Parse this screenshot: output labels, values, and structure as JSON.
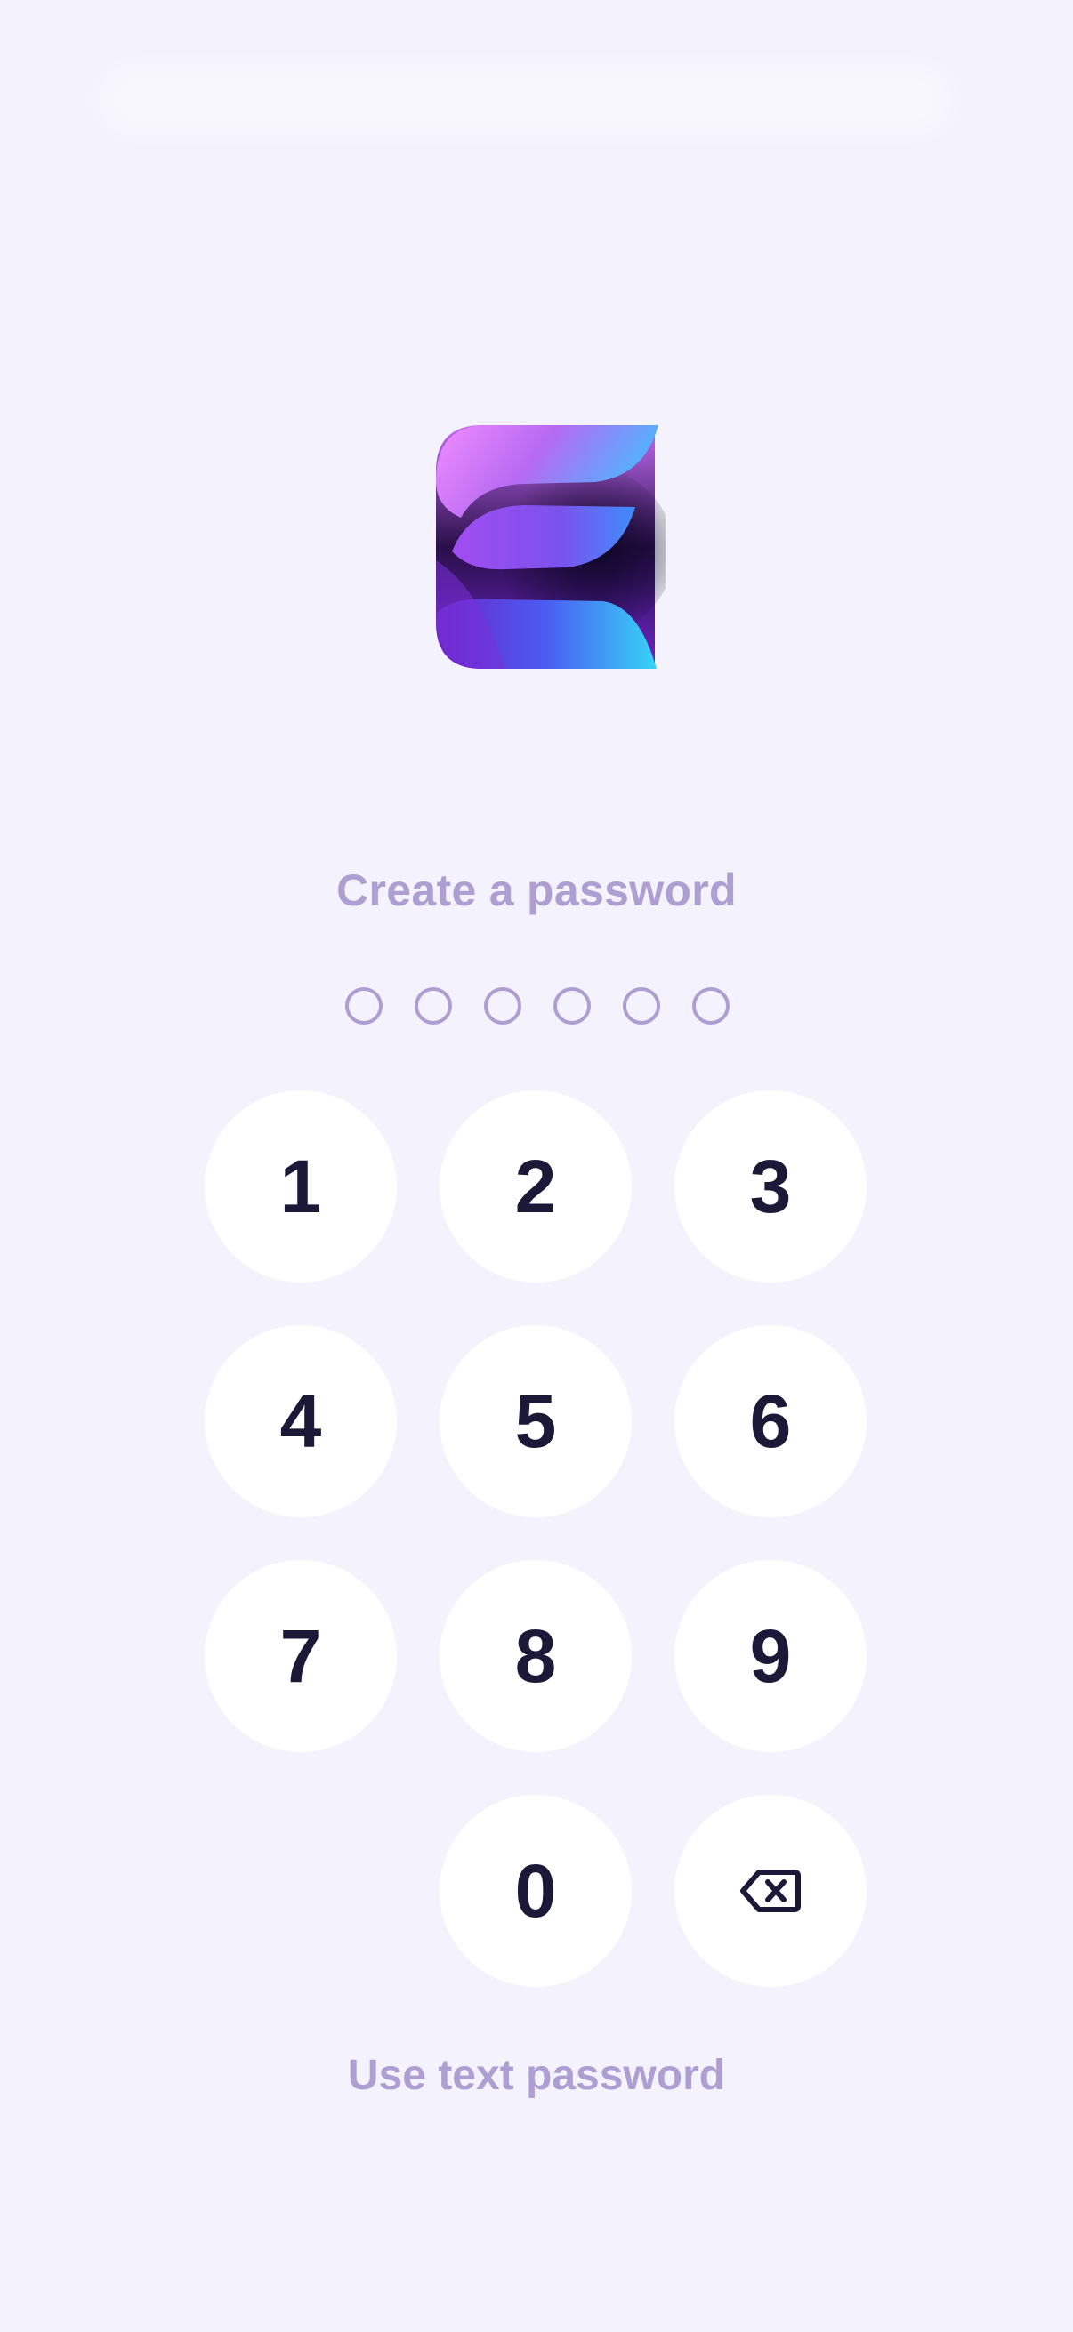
{
  "app": {
    "logo_icon": "stylized-e-logo-icon"
  },
  "prompt": {
    "title": "Create a password",
    "length": 6,
    "filled": 0
  },
  "keypad": {
    "keys": [
      "1",
      "2",
      "3",
      "4",
      "5",
      "6",
      "7",
      "8",
      "9",
      "0"
    ],
    "backspace_icon": "backspace-icon"
  },
  "footer": {
    "alt_label": "Use text password"
  },
  "colors": {
    "background": "#f4f3fd",
    "accent_muted": "#ad9fd1",
    "key_background": "#ffffff",
    "key_text": "#1c1838"
  }
}
